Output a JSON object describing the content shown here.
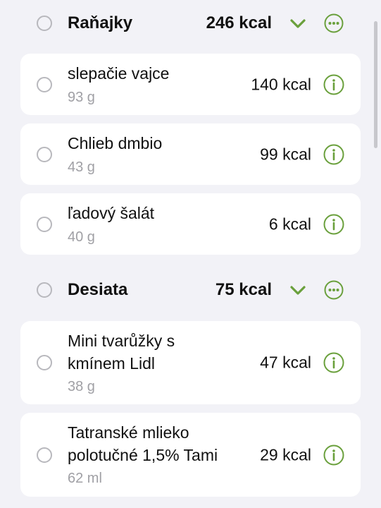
{
  "colors": {
    "accent": "#6aa03c",
    "background": "#f2f2f7",
    "card": "#ffffff",
    "secondary_text": "#a0a0a5"
  },
  "meals": [
    {
      "name": "Raňajky",
      "kcal": "246 kcal",
      "items": [
        {
          "name": "slepačie vajce",
          "amount": "93 g",
          "kcal": "140 kcal"
        },
        {
          "name": "Chlieb dmbio",
          "amount": "43 g",
          "kcal": "99 kcal"
        },
        {
          "name": "ľadový šalát",
          "amount": "40 g",
          "kcal": "6 kcal"
        }
      ]
    },
    {
      "name": "Desiata",
      "kcal": "75 kcal",
      "items": [
        {
          "name": "Mini tvarůžky s kmínem Lidl",
          "amount": "38 g",
          "kcal": "47 kcal"
        },
        {
          "name": "Tatranské mlieko polotučné 1,5% Tami",
          "amount": "62 ml",
          "kcal": "29 kcal"
        }
      ]
    }
  ],
  "icons": {
    "select": "radio-circle-icon",
    "expand": "chevron-down-icon",
    "more": "ellipsis-circle-icon",
    "info": "info-circle-icon"
  }
}
